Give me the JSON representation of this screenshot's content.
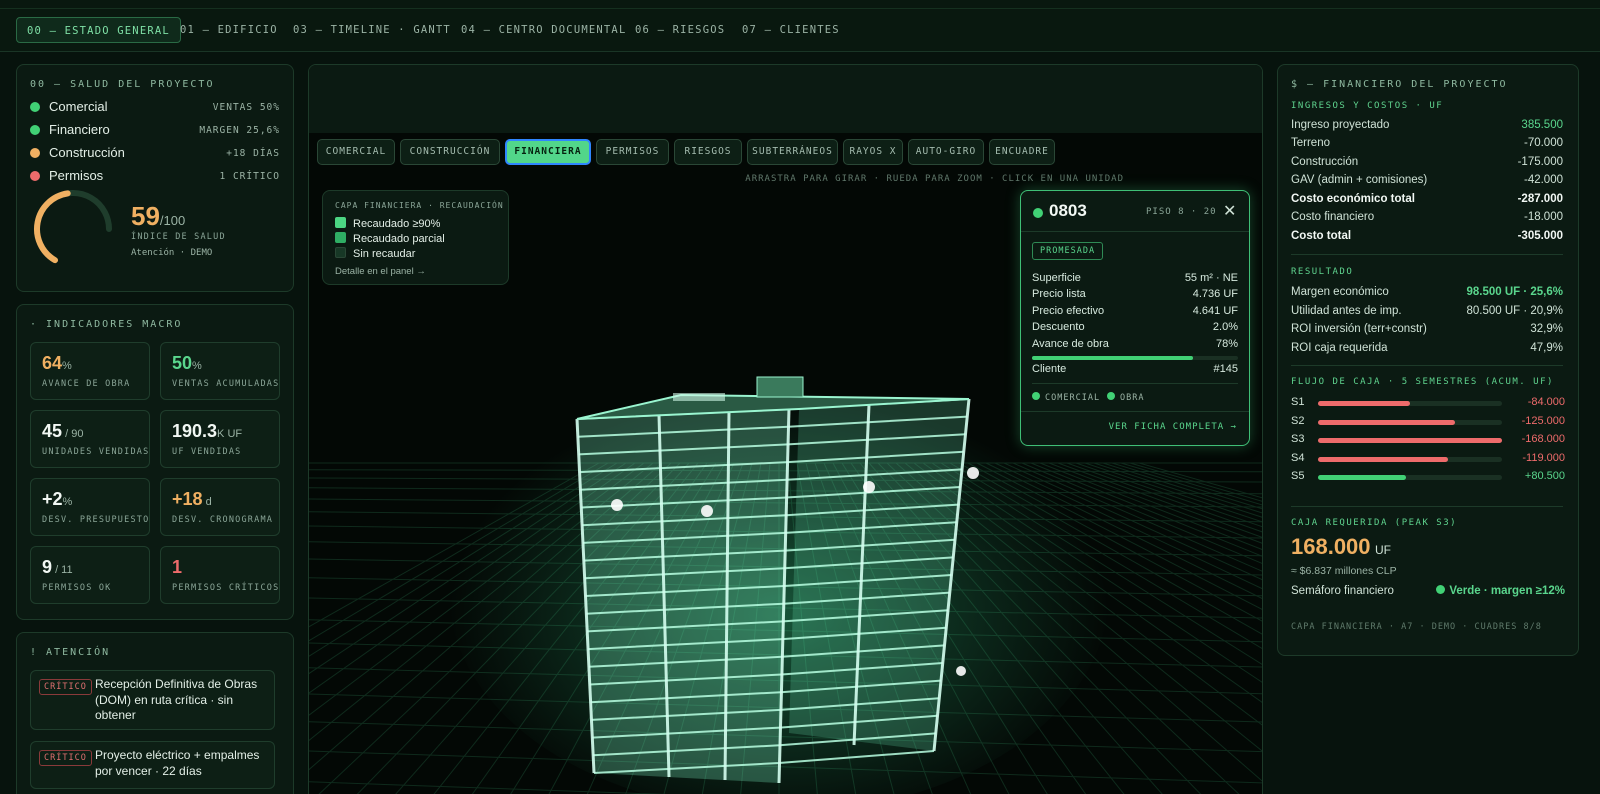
{
  "nav": {
    "tabs": [
      "00 — ESTADO GENERAL",
      "01 — EDIFICIO",
      "03 — TIMELINE · GANTT",
      "04 — CENTRO DOCUMENTAL",
      "06 — RIESGOS",
      "07 — CLIENTES"
    ],
    "active": "00 — ESTADO GENERAL"
  },
  "health": {
    "title": "00 — SALUD DEL PROYECTO",
    "rows": [
      {
        "label": "Comercial",
        "value": "VENTAS 50%",
        "color": "#41d175"
      },
      {
        "label": "Financiero",
        "value": "MARGEN 25,6%",
        "color": "#41d175"
      },
      {
        "label": "Construcción",
        "value": "+18 DÍAS",
        "color": "#f0b062"
      },
      {
        "label": "Permisos",
        "value": "1 CRÍTICO",
        "color": "#ee6b6b"
      }
    ],
    "score": "59",
    "score_max": "/100",
    "score_fraction": 0.59,
    "score_label": "ÍNDICE DE SALUD",
    "score_sub": "Atención · DEMO"
  },
  "macro": {
    "title": "· INDICADORES MACRO",
    "kpis": [
      {
        "value": "64",
        "unit": "%",
        "label": "AVANCE DE OBRA",
        "color": "#f0b062"
      },
      {
        "value": "50",
        "unit": "%",
        "label": "VENTAS ACUMULADAS",
        "color": "#5ad68d"
      },
      {
        "value": "45",
        "unit": " / 90",
        "label": "UNIDADES VENDIDAS",
        "color": "#f2f8f4"
      },
      {
        "value": "190.3",
        "unit": "K UF",
        "label": "UF VENDIDAS",
        "color": "#f2f8f4"
      },
      {
        "value": "+2",
        "unit": "%",
        "label": "DESV. PRESUPUESTO",
        "color": "#f2f8f4"
      },
      {
        "value": "+18",
        "unit": " d",
        "label": "DESV. CRONOGRAMA",
        "color": "#f0b062"
      },
      {
        "value": "9",
        "unit": " / 11",
        "label": "PERMISOS OK",
        "color": "#f2f8f4"
      },
      {
        "value": "1",
        "unit": "",
        "label": "PERMISOS CRÍTICOS",
        "color": "#ee6b6b"
      }
    ]
  },
  "attention": {
    "title": "! ATENCIÓN",
    "items": [
      {
        "badge": "CRÍTICO",
        "text": "Recepción Definitiva de Obras (DOM) en ruta crítica · sin obtener"
      },
      {
        "badge": "CRÍTICO",
        "text": "Proyecto eléctrico + empalmes por vencer · 22 días"
      }
    ]
  },
  "layers": {
    "tabs": [
      "COMERCIAL",
      "CONSTRUCCIÓN",
      "FINANCIERA",
      "PERMISOS",
      "RIESGOS",
      "SUBTERRÁNEOS",
      "RAYOS X",
      "AUTO-GIRO",
      "ENCUADRE"
    ],
    "active": "FINANCIERA",
    "hint": "ARRASTRA PARA GIRAR · RUEDA PARA ZOOM · CLICK EN UNA UNIDAD"
  },
  "legend": {
    "title": "CAPA FINANCIERA · RECAUDACIÓN",
    "items": [
      {
        "label": "Recaudado ≥90%",
        "color": "#4cd683"
      },
      {
        "label": "Recaudado parcial",
        "color": "#2fae64"
      },
      {
        "label": "Sin recaudar",
        "color": "#173826"
      }
    ],
    "link": "Detalle en el panel →"
  },
  "unit": {
    "id": "0803",
    "floor": "PISO 8 · 20",
    "status": "PROMESADA",
    "rows": [
      {
        "k": "Superficie",
        "v": "55 m² · NE"
      },
      {
        "k": "Precio lista",
        "v": "4.736 UF"
      },
      {
        "k": "Precio efectivo",
        "v": "4.641 UF"
      },
      {
        "k": "Descuento",
        "v": "2.0%"
      },
      {
        "k": "Avance de obra",
        "v": "78%"
      },
      {
        "k": "Cliente",
        "v": "#145"
      }
    ],
    "progress": 0.78,
    "tags": [
      "COMERCIAL",
      "OBRA"
    ],
    "link": "VER FICHA COMPLETA →"
  },
  "finance": {
    "title": "$ — FINANCIERO DEL PROYECTO",
    "section1": "INGRESOS Y COSTOS · UF",
    "rows1": [
      {
        "k": "Ingreso proyectado",
        "v": "385.500",
        "color": "#5ad68d",
        "bold": false
      },
      {
        "k": "Terreno",
        "v": "-70.000",
        "color": "#cfe2d6",
        "bold": false
      },
      {
        "k": "Construcción",
        "v": "-175.000",
        "color": "#cfe2d6",
        "bold": false
      },
      {
        "k": "GAV (admin + comisiones)",
        "v": "-42.000",
        "color": "#cfe2d6",
        "bold": false
      },
      {
        "k": "Costo económico total",
        "v": "-287.000",
        "color": "#f2f8f4",
        "bold": true
      },
      {
        "k": "Costo financiero",
        "v": "-18.000",
        "color": "#cfe2d6",
        "bold": false
      },
      {
        "k": "Costo total",
        "v": "-305.000",
        "color": "#f2f8f4",
        "bold": true
      }
    ],
    "section2": "RESULTADO",
    "rows2": [
      {
        "k": "Margen económico",
        "v": "98.500 UF · 25,6%",
        "color": "#5ad68d",
        "bold": true
      },
      {
        "k": "Utilidad antes de imp.",
        "v": "80.500 UF · 20,9%",
        "color": "#cfe2d6",
        "bold": false
      },
      {
        "k": "ROI inversión (terr+constr)",
        "v": "32,9%",
        "color": "#cfe2d6",
        "bold": false
      },
      {
        "k": "ROI caja requerida",
        "v": "47,9%",
        "color": "#cfe2d6",
        "bold": false
      }
    ],
    "section3": "FLUJO DE CAJA · 5 SEMESTRES (ACUM. UF)",
    "cashflow": [
      {
        "label": "S1",
        "value": "-84.000",
        "amount": -84000
      },
      {
        "label": "S2",
        "value": "-125.000",
        "amount": -125000
      },
      {
        "label": "S3",
        "value": "-168.000",
        "amount": -168000
      },
      {
        "label": "S4",
        "value": "-119.000",
        "amount": -119000
      },
      {
        "label": "S5",
        "value": "+80.500",
        "amount": 80500
      }
    ],
    "section4": "CAJA REQUERIDA (PEAK S3)",
    "peak": "168.000",
    "peak_unit": "UF",
    "peak_clp": "≈ $6.837 millones CLP",
    "semaforo_label": "Semáforo financiero",
    "semaforo_value": "Verde · margen ≥12%",
    "footer": "CAPA FINANCIERA · A7 · DEMO · CUADRES 8/8"
  },
  "colors": {
    "green": "#41d175",
    "amber": "#f0b062",
    "red": "#ee6b6b",
    "accent": "#52d68a"
  }
}
